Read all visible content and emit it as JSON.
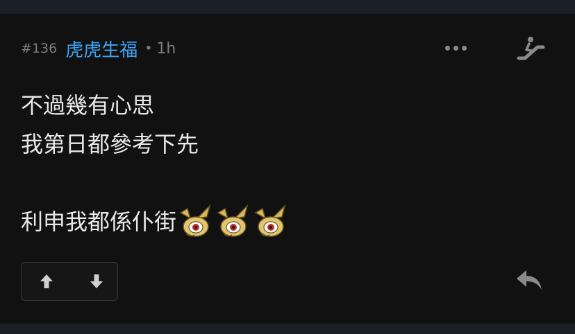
{
  "post": {
    "floor": "#136",
    "author": "虎虎生福",
    "separator": "•",
    "time": "1h",
    "lines": [
      "不過幾有心思",
      "我第日都參考下先",
      "",
      "利申我都係仆街"
    ],
    "sticker_count": 3
  },
  "icons": {
    "more": "more-dots-icon",
    "escalator": "escalator-icon",
    "upvote": "arrow-up-icon",
    "downvote": "arrow-down-icon",
    "reply": "reply-icon"
  },
  "colors": {
    "background": "#111111",
    "author": "#3fa3f3",
    "muted": "#7d7d7d",
    "text": "#e9e9e9"
  }
}
